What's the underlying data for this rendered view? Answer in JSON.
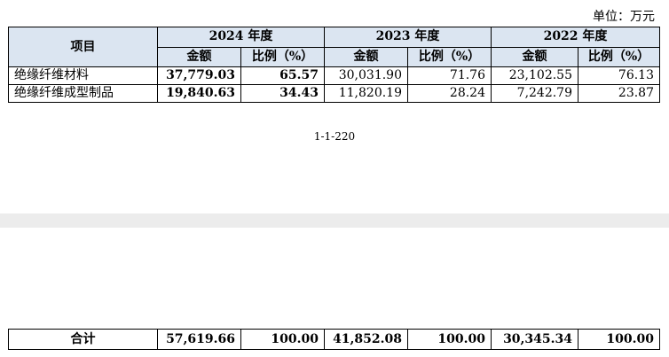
{
  "unit_label": "单位：万元",
  "table": {
    "header": {
      "item": "项目",
      "years": [
        {
          "label": "2024 年度",
          "amount": "金额",
          "ratio": "比例（%）"
        },
        {
          "label": "2023 年度",
          "amount": "金额",
          "ratio": "比例（%）"
        },
        {
          "label": "2022 年度",
          "amount": "金额",
          "ratio": "比例（%）"
        }
      ]
    },
    "rows": [
      {
        "name": "绝缘纤维材料",
        "a2024": "37,779.03",
        "r2024": "65.57",
        "a2023": "30,031.90",
        "r2023": "71.76",
        "a2022": "23,102.55",
        "r2022": "76.13"
      },
      {
        "name": "绝缘纤维成型制品",
        "a2024": "19,840.63",
        "r2024": "34.43",
        "a2023": "11,820.19",
        "r2023": "28.24",
        "a2022": "7,242.79",
        "r2022": "23.87"
      }
    ]
  },
  "page_number": "1-1-220",
  "total": {
    "name": "合计",
    "a2024": "57,619.66",
    "r2024": "100.00",
    "a2023": "41,852.08",
    "r2023": "100.00",
    "a2022": "30,345.34",
    "r2022": "100.00"
  }
}
